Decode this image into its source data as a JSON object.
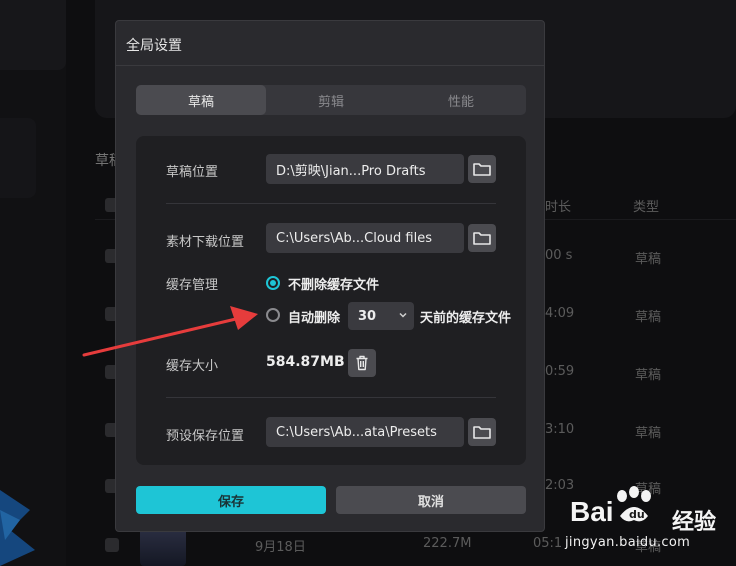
{
  "background": {
    "section_title": "草稿",
    "columns": {
      "duration": "时长",
      "type": "类型"
    },
    "rows": [
      {
        "duration": "00 s",
        "type": "草稿"
      },
      {
        "duration": "4:09",
        "type": "草稿"
      },
      {
        "duration": "0:59",
        "type": "草稿"
      },
      {
        "duration": "3:10",
        "type": "草稿"
      },
      {
        "duration": "2:03",
        "type": "草稿"
      },
      {
        "date": "9月18日",
        "size": "222.7M",
        "duration": "05:1",
        "type": "草稿"
      }
    ]
  },
  "dialog": {
    "title": "全局设置",
    "tabs": [
      {
        "label": "草稿",
        "active": true
      },
      {
        "label": "剪辑",
        "active": false
      },
      {
        "label": "性能",
        "active": false
      }
    ],
    "draft_location": {
      "label": "草稿位置",
      "value": "D:\\剪映\\Jian...Pro Drafts"
    },
    "download_location": {
      "label": "素材下载位置",
      "value": "C:\\Users\\Ab...Cloud files"
    },
    "cache": {
      "label": "缓存管理",
      "option_keep": "不删除缓存文件",
      "option_auto": "自动删除",
      "days": "30",
      "days_suffix": "天前的缓存文件",
      "selected": "keep"
    },
    "cache_size": {
      "label": "缓存大小",
      "value": "584.87MB"
    },
    "preset_location": {
      "label": "预设保存位置",
      "value": "C:\\Users\\Ab...ata\\Presets"
    },
    "save_label": "保存",
    "cancel_label": "取消"
  },
  "watermark": {
    "logo": "Bai",
    "logo_cn": "经验",
    "url": "jingyan.baidu.com"
  },
  "colors": {
    "accent": "#1ec5d6",
    "arrow": "#e63c3c"
  }
}
